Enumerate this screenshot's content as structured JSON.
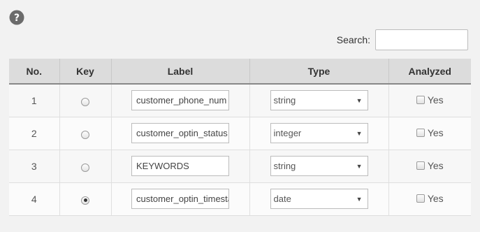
{
  "help": {
    "icon": "question-circle-icon"
  },
  "search": {
    "label": "Search:",
    "value": "",
    "placeholder": ""
  },
  "table": {
    "headers": {
      "no": "No.",
      "key": "Key",
      "label": "Label",
      "type": "Type",
      "analyzed": "Analyzed"
    },
    "rows": [
      {
        "no": "1",
        "key_selected": false,
        "label": "customer_phone_num",
        "type": "string",
        "analyzed_label": "Yes",
        "analyzed_checked": false
      },
      {
        "no": "2",
        "key_selected": false,
        "label": "customer_optin_status",
        "type": "integer",
        "analyzed_label": "Yes",
        "analyzed_checked": false
      },
      {
        "no": "3",
        "key_selected": false,
        "label": "KEYWORDS",
        "type": "string",
        "analyzed_label": "Yes",
        "analyzed_checked": false
      },
      {
        "no": "4",
        "key_selected": true,
        "label": "customer_optin_timestamp",
        "type": "date",
        "analyzed_label": "Yes",
        "analyzed_checked": false
      }
    ]
  }
}
